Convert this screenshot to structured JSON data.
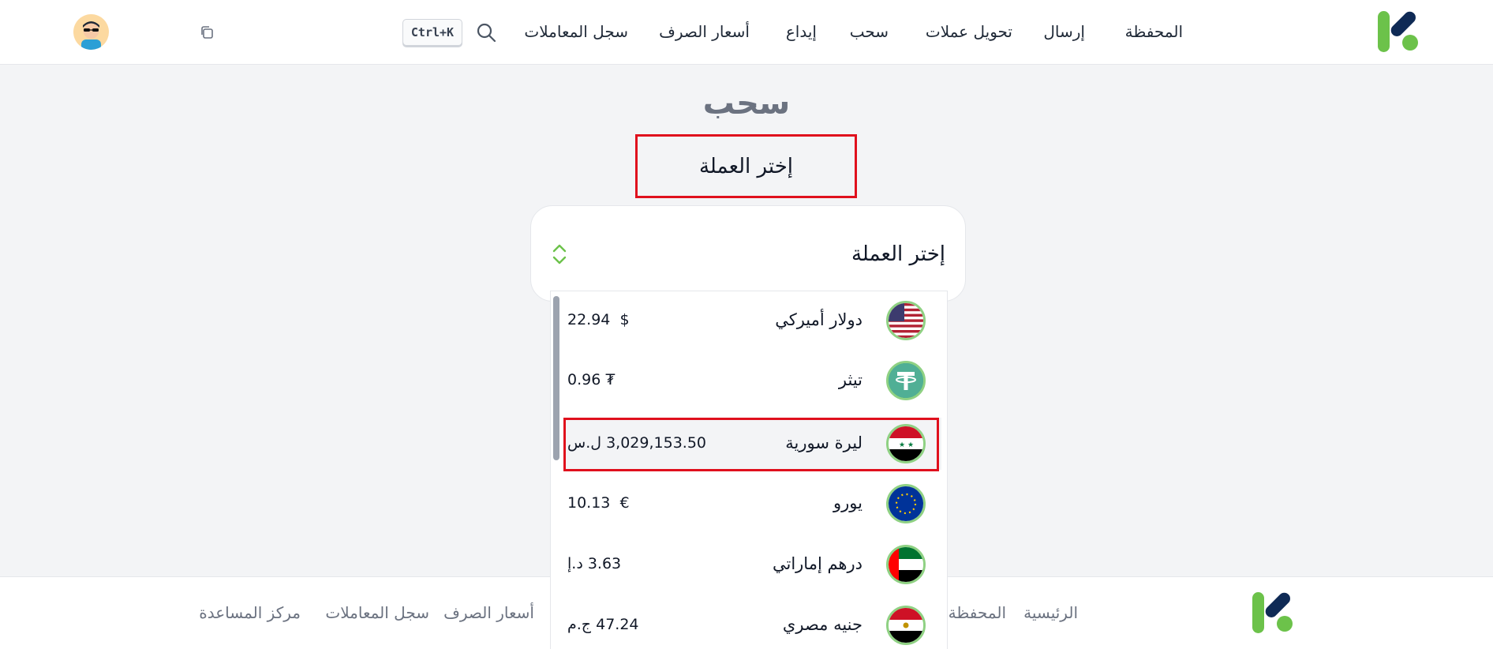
{
  "header": {
    "nav": [
      {
        "label": "المحفظة"
      },
      {
        "label": "إرسال"
      },
      {
        "label": "تحويل عملات"
      },
      {
        "label": "سحب"
      },
      {
        "label": "إيداع"
      },
      {
        "label": "أسعار الصرف"
      },
      {
        "label": "سجل المعاملات"
      }
    ],
    "shortcut": "Ctrl+K",
    "icons": {
      "search": "search-icon",
      "copy": "copy-icon",
      "avatar": "avatar"
    }
  },
  "main": {
    "page_title": "سحب",
    "highlight_label": "إختر العملة",
    "select_label": "إختر العملة",
    "options": [
      {
        "name": "دولار أميركي",
        "amount": "22.94",
        "symbol": "$",
        "flag": "us-flag"
      },
      {
        "name": "تيثر",
        "amount": "0.96",
        "symbol": "₮",
        "flag": "tether-logo"
      },
      {
        "name": "ليرة سورية",
        "amount": "3,029,153.50",
        "symbol": "ل.س",
        "flag": "syria-flag"
      },
      {
        "name": "يورو",
        "amount": "10.13",
        "symbol": "€",
        "flag": "eu-flag"
      },
      {
        "name": "درهم إماراتي",
        "amount": "3.63",
        "symbol": "د.إ",
        "flag": "uae-flag"
      },
      {
        "name": "جنيه مصري",
        "amount": "47.24",
        "symbol": "ج.م",
        "flag": "egypt-flag"
      }
    ]
  },
  "footer": {
    "links": [
      {
        "label": "الرئيسية"
      },
      {
        "label": "المحفظة"
      },
      {
        "label": "أسعار الصرف"
      },
      {
        "label": "سجل المعاملات"
      },
      {
        "label": "مركز المساعدة"
      }
    ]
  },
  "colors": {
    "brand_green": "#6cc24a",
    "brand_navy": "#0f2a55",
    "highlight_red": "#e0101d"
  }
}
